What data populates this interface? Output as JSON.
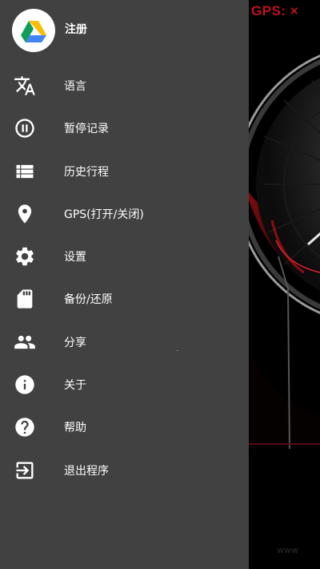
{
  "status": {
    "gps": "GPS: ×"
  },
  "watermark": "www",
  "drawer": {
    "header": {
      "label": "注册",
      "avatar_icon": "google-drive-icon"
    },
    "items": [
      {
        "label": "语言",
        "icon": "translate-icon"
      },
      {
        "label": "暂停记录",
        "icon": "pause-circle-icon"
      },
      {
        "label": "历史行程",
        "icon": "list-icon"
      },
      {
        "label": "GPS(打开/关闭)",
        "icon": "location-pin-icon"
      },
      {
        "label": "设置",
        "icon": "gear-icon"
      },
      {
        "label": "备份/还原",
        "icon": "sd-card-icon"
      },
      {
        "label": "分享",
        "icon": "people-icon"
      },
      {
        "label": "关于",
        "icon": "info-icon"
      },
      {
        "label": "帮助",
        "icon": "help-icon"
      },
      {
        "label": "退出程序",
        "icon": "exit-icon"
      }
    ]
  },
  "colors": {
    "drawer": "#414141",
    "accent_red": "#c1121c",
    "background": "#000000"
  }
}
